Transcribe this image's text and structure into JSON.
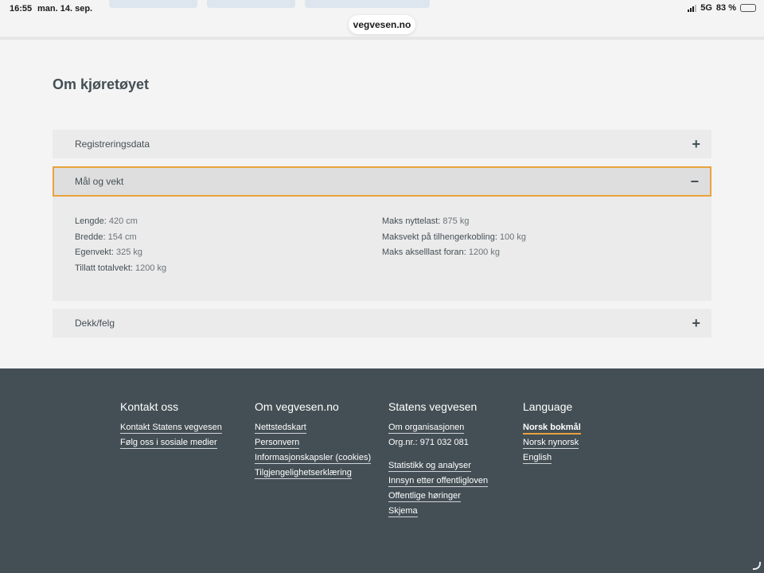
{
  "status": {
    "time": "16:55",
    "date": "man. 14. sep.",
    "network": "5G",
    "battery": "83 %"
  },
  "browser": {
    "url": "vegvesen.no"
  },
  "main": {
    "title": "Om kjøretøyet",
    "sections": [
      {
        "label": "Registreringsdata",
        "toggle": "+"
      },
      {
        "label": "Mål og vekt",
        "toggle": "−"
      },
      {
        "label": "Dekk/felg",
        "toggle": "+"
      }
    ],
    "measures_left": [
      {
        "k": "Lengde:",
        "v": "420 cm"
      },
      {
        "k": "Bredde:",
        "v": "154 cm"
      },
      {
        "k": "Egenvekt:",
        "v": "325 kg"
      },
      {
        "k": "Tillatt totalvekt:",
        "v": "1200 kg"
      }
    ],
    "measures_right": [
      {
        "k": "Maks nyttelast:",
        "v": "875 kg"
      },
      {
        "k": "Maksvekt på tilhengerkobling:",
        "v": "100 kg"
      },
      {
        "k": "Maks akselllast foran:",
        "v": "1200 kg"
      }
    ]
  },
  "footer": {
    "contact": {
      "title": "Kontakt oss",
      "links": [
        "Kontakt Statens vegvesen",
        "Følg oss i sosiale medier"
      ]
    },
    "about": {
      "title": "Om vegvesen.no",
      "links": [
        "Nettstedskart",
        "Personvern",
        "Informasjonskapsler (cookies)",
        "Tilgjengelighetserklæring"
      ]
    },
    "svv": {
      "title": "Statens vegvesen",
      "org_link": "Om organisasjonen",
      "orgnr": "Org.nr.: 971 032 081",
      "links": [
        "Statistikk og analyser",
        "Innsyn etter offentligloven",
        "Offentlige høringer",
        "Skjema"
      ]
    },
    "language": {
      "title": "Language",
      "links": [
        "Norsk bokmål",
        "Norsk nynorsk",
        "English"
      ]
    }
  },
  "colors": {
    "accent": "#e8a33d",
    "footer_bg": "#444f55",
    "panel_bg": "#ebebeb"
  }
}
